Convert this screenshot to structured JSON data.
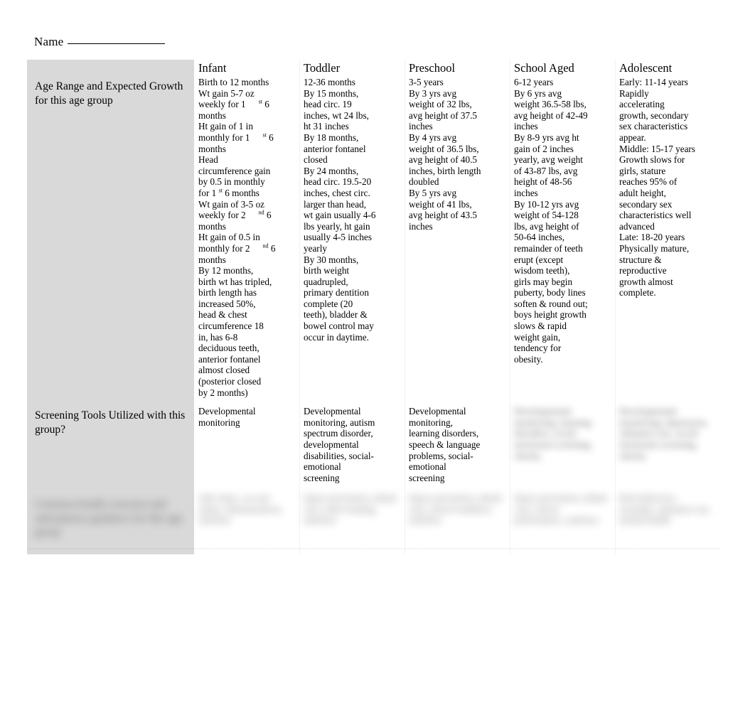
{
  "document": {
    "name_label": "Name",
    "name_blank": ""
  },
  "table": {
    "row_labels": [
      "Age Range and Expected Growth for this age group",
      "Screening Tools Utilized with this group?",
      ""
    ],
    "column_headers": [
      "Infant",
      "Toddler",
      "Preschool",
      "School Aged",
      "Adolescent"
    ],
    "growth_row": {
      "infant": [
        "Birth to 12 months",
        "Wt gain 5-7 oz weekly for 1 st 6 months",
        "Ht gain of 1 in monthly for 1 st 6 months",
        "Head circumference gain by 0.5 in monthly for 1 st 6 months",
        "Wt gain of 3-5 oz weekly for 2 nd 6 months",
        "Ht gain of 0.5 in monthly for 2 nd 6 months",
        "By 12 months, birth wt has tripled, birth length has increased 50%, head & chest circumference 18 in, has 6-8 deciduous teeth, anterior fontanel almost closed (posterior closed by 2 months)"
      ],
      "toddler": [
        "12-36 months",
        "By 15 months, head circ. 19 inches, wt 24 lbs, ht 31 inches",
        "By 18 months, anterior fontanel closed",
        "By 24 months, head circ. 19.5-20 inches, chest circ. larger than head, wt gain usually 4-6 lbs yearly, ht gain usually 4-5 inches yearly",
        "By 30 months, birth weight quadrupled, primary dentition complete (20 teeth), bladder & bowel control may occur in daytime."
      ],
      "preschool": [
        "3-5 years",
        "By 3 yrs avg weight of 32 lbs, avg height of 37.5 inches",
        "By 4 yrs avg weight of 36.5 lbs, avg height of 40.5 inches, birth length doubled",
        "By 5 yrs avg weight of 41 lbs, avg height of 43.5 inches"
      ],
      "school_aged": [
        "6-12 years",
        "By 6 yrs avg weight 36.5-58 lbs, avg height of 42-49 inches",
        "By 8-9 yrs avg ht gain of 2 inches yearly, avg weight of 43-87 lbs, avg height of 48-56 inches",
        "By 10-12 yrs avg weight of 54-128 lbs, avg height of 50-64 inches, remainder of teeth erupt (except wisdom teeth), girls may begin puberty, body lines soften & round out; boys height growth slows & rapid weight gain, tendency for obesity."
      ],
      "adolescent": [
        "Early: 11-14 years",
        "Rapidly accelerating growth, secondary sex characteristics appear.",
        "Middle: 15-17 years",
        "Growth slows for girls, stature reaches 95% of adult height, secondary sex characteristics well advanced",
        "Late: 18-20 years",
        "Physically mature, structure & reproductive growth almost complete."
      ]
    },
    "screening_row": {
      "infant": "Developmental monitoring",
      "toddler": "Developmental monitoring, autism spectrum disorder, developmental disabilities, social-emotional screening",
      "preschool": "Developmental monitoring, learning disorders, speech & language problems, social-emotional screening",
      "school_aged": "Developmental monitoring, learning disorders, social-emotional screening, obesity",
      "adolescent": "Developmental monitoring, depression, substance use, social-emotional screening, obesity"
    },
    "third_row": {
      "label": "Common health concerns and anticipatory guidance for this age group",
      "infant": "Safe sleep, car seat safety, immunizations, nutrition",
      "toddler": "Injury prevention, dental care, toilet training, nutrition",
      "preschool": "Injury prevention, dental care, school readiness, nutrition",
      "school_aged": "Injury prevention, dental care, school performance, nutrition",
      "adolescent": "Risk behaviors, sexuality, substance use, mental health"
    }
  }
}
